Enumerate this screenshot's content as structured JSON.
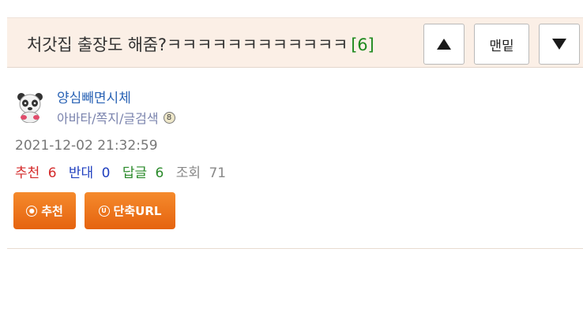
{
  "header": {
    "title": "처갓집 출장도 해줌?ㅋㅋㅋㅋㅋㅋㅋㅋㅋㅋㅋㅋ",
    "reply_count": "[6]",
    "up_icon": "triangle-up-icon",
    "bottom_label": "맨밑",
    "down_icon": "triangle-down-icon"
  },
  "author": {
    "avatar_icon": "panda-avatar-icon",
    "nickname": "양심빼면시체",
    "links": "아바타/쪽지/글검색",
    "level": "8"
  },
  "post": {
    "timestamp": "2021-12-02 21:32:59",
    "stats": {
      "recommend_label": "추천",
      "recommend_value": "6",
      "oppose_label": "반대",
      "oppose_value": "0",
      "reply_label": "답글",
      "reply_value": "6",
      "view_label": "조회",
      "view_value": "71"
    }
  },
  "actions": {
    "recommend_icon": "◎",
    "recommend_label": "추천",
    "url_icon": "U",
    "url_label": "단축URL"
  },
  "colors": {
    "header_bg": "#fbefe6",
    "recommend": "#d42a2a",
    "oppose": "#1f3fbf",
    "reply": "#2a8a2a",
    "view": "#888888",
    "nickname": "#2a63b5",
    "action_button": "#ef7420"
  }
}
